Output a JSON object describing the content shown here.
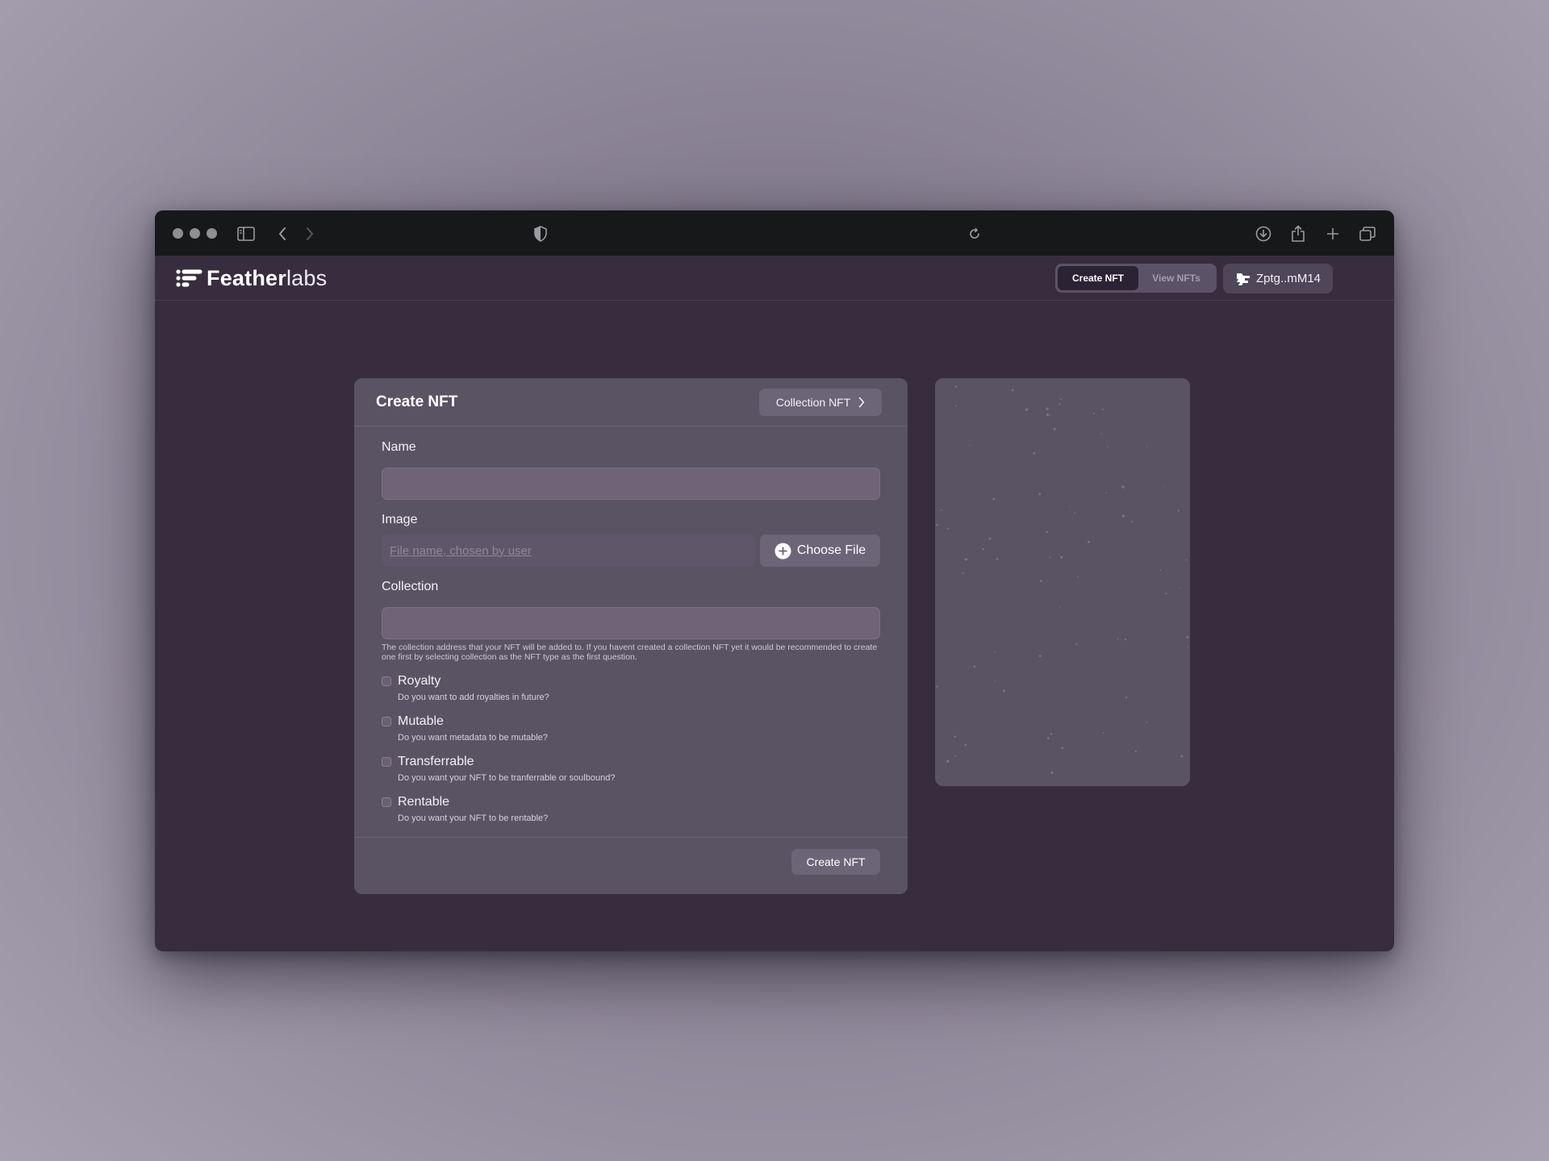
{
  "browser": {
    "icons": [
      "sidebar-icon",
      "back-icon",
      "forward-icon",
      "shield-icon",
      "reload-icon",
      "download-icon",
      "share-icon",
      "new-tab-icon",
      "tabs-icon"
    ]
  },
  "header": {
    "logo": {
      "strong": "Feather",
      "light": "labs"
    },
    "tabs": [
      {
        "label": "Create NFT",
        "active": true
      },
      {
        "label": "View NFTs",
        "active": false
      }
    ],
    "wallet": {
      "label": "Zptg..mM14",
      "icon": "wallet-avatar-icon"
    }
  },
  "form": {
    "title": "Create NFT",
    "type_button": "Collection NFT",
    "name": {
      "label": "Name",
      "value": ""
    },
    "image": {
      "label": "Image",
      "placeholder": "File name, chosen by user",
      "choose_label": "Choose File"
    },
    "collection": {
      "label": "Collection",
      "value": "",
      "helper": "The collection address that your NFT will be added to. If you havent created a collection NFT yet it would be recommended to create one first by selecting collection as the NFT type as the first question."
    },
    "options": [
      {
        "label": "Royalty",
        "description": "Do you want to add royalties in future?",
        "checked": false
      },
      {
        "label": "Mutable",
        "description": "Do you want metadata to be mutable?",
        "checked": false
      },
      {
        "label": "Transferrable",
        "description": "Do you want your NFT to be tranferrable or soulbound?",
        "checked": false
      },
      {
        "label": "Rentable",
        "description": "Do you want your NFT to be rentable?",
        "checked": false
      }
    ],
    "submit_label": "Create NFT"
  },
  "colors": {
    "app_background": "#372d3f",
    "card": "#5a5364",
    "input": "#6f6378",
    "button": "#6c6477",
    "active_tab": "#2b2233"
  }
}
